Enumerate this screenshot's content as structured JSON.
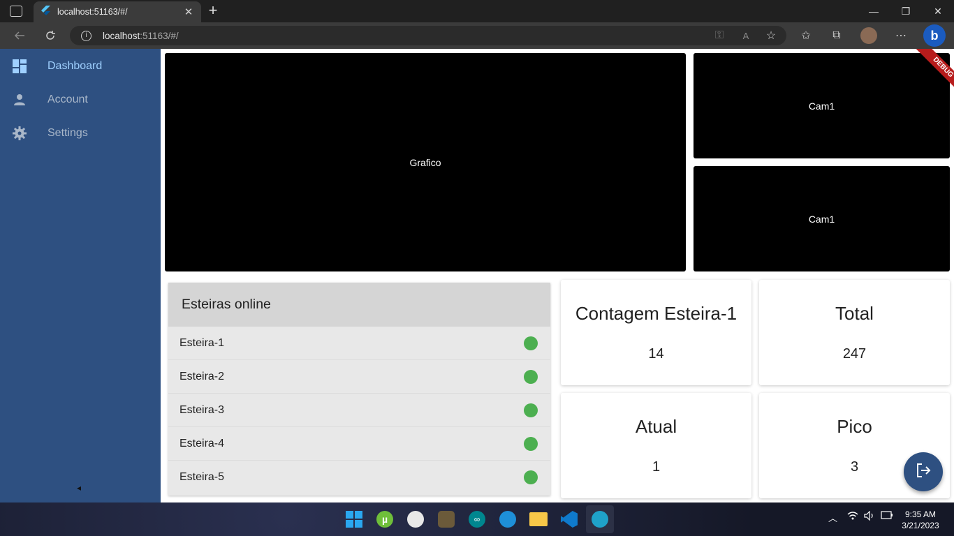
{
  "browser": {
    "tab_title": "localhost:51163/#/",
    "tab_close": "✕",
    "new_tab": "+",
    "url_host": "localhost",
    "url_rest": ":51163/#/",
    "window_minimize": "—",
    "window_restore": "❐",
    "window_close": "✕"
  },
  "sidebar": {
    "items": [
      {
        "label": "Dashboard",
        "icon": "dashboard-icon",
        "active": true
      },
      {
        "label": "Account",
        "icon": "person-icon",
        "active": false
      },
      {
        "label": "Settings",
        "icon": "gear-icon",
        "active": false
      }
    ],
    "collapse_glyph": "◂"
  },
  "panels": {
    "chart_label": "Grafico",
    "cam_top_label": "Cam1",
    "cam_bottom_label": "Cam1"
  },
  "debug_banner": "DEBUG",
  "online_list": {
    "title": "Esteiras online",
    "rows": [
      "Esteira-1",
      "Esteira-2",
      "Esteira-3",
      "Esteira-4",
      "Esteira-5"
    ],
    "status_color": "#4caf50"
  },
  "cards": [
    {
      "title": "Contagem Esteira-1",
      "value": "14"
    },
    {
      "title": "Total",
      "value": "247"
    },
    {
      "title": "Atual",
      "value": "1"
    },
    {
      "title": "Pico",
      "value": "3"
    }
  ],
  "colors": {
    "sidebar": "#2e5081",
    "active_nav": "#9fd0ff",
    "fab": "#2e5081"
  },
  "taskbar": {
    "time": "9:35 AM",
    "date": "3/21/2023",
    "apps": [
      "windows-start-icon",
      "utorrent-icon",
      "app-icon",
      "app-icon",
      "arduino-icon",
      "edge-icon",
      "file-explorer-icon",
      "vscode-icon",
      "edge-dev-icon"
    ]
  }
}
